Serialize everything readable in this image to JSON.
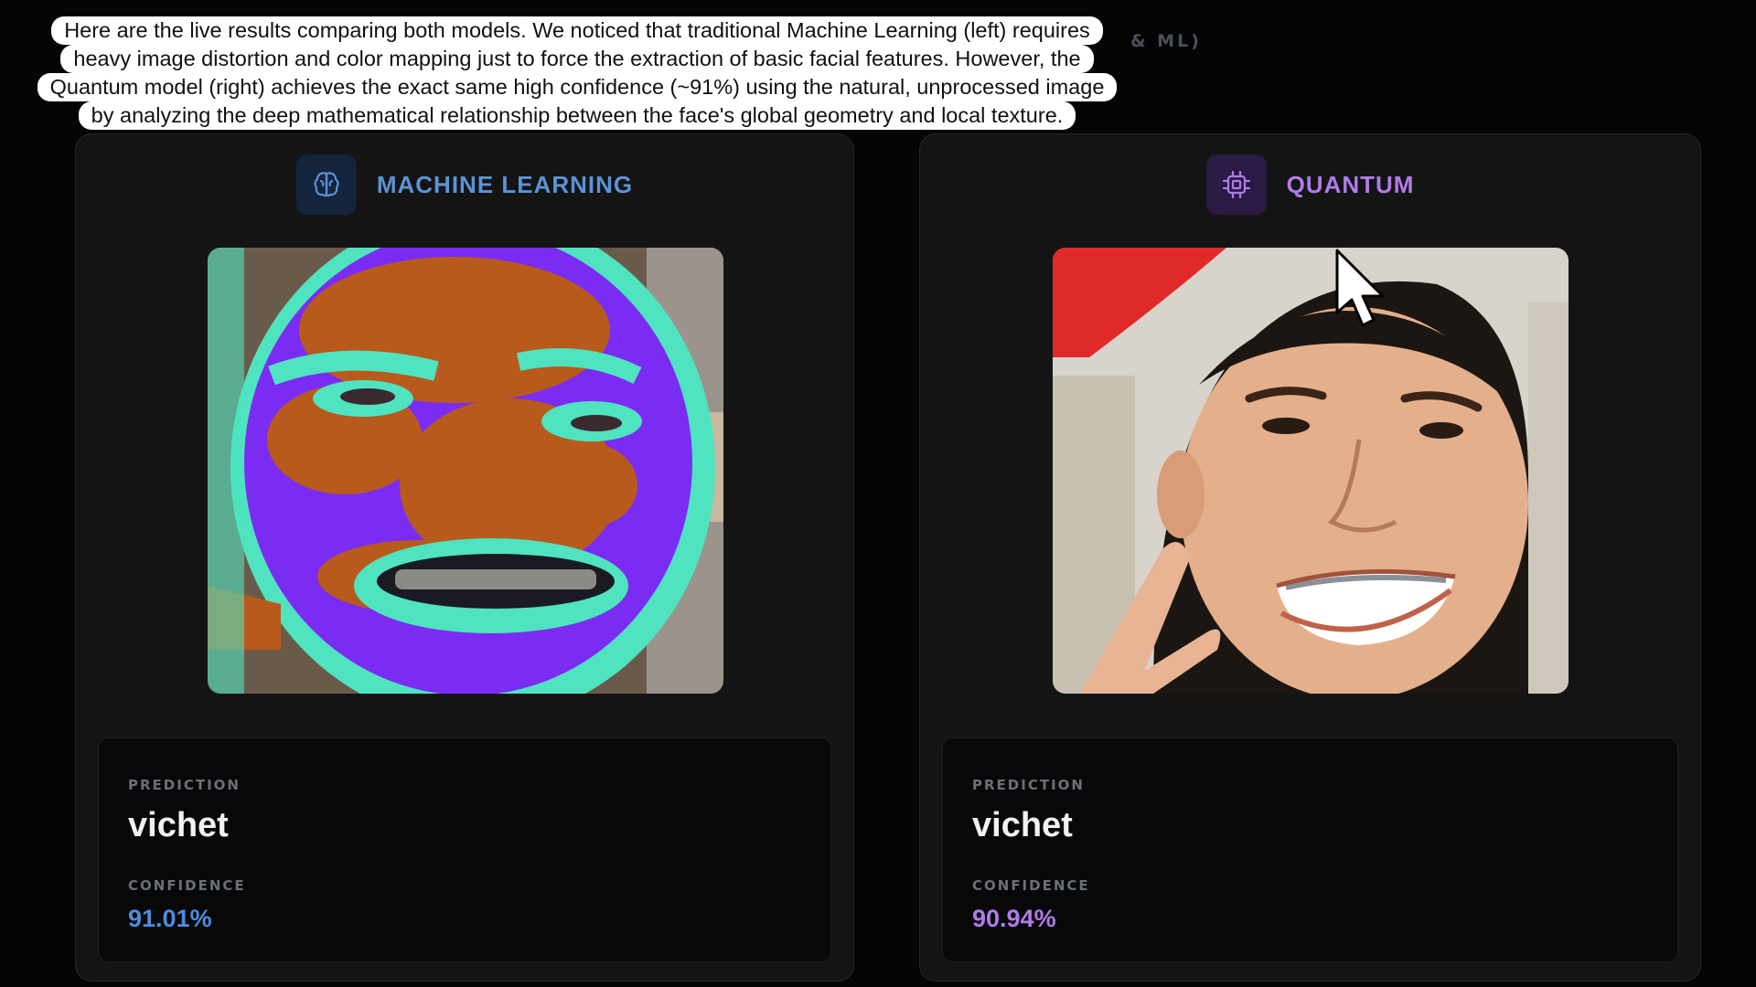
{
  "header": {
    "title_fragment": "& ML)"
  },
  "caption": {
    "lines": [
      "Here are the live results comparing both models. We noticed that traditional Machine Learning (left) requires",
      "heavy image distortion and color mapping just to force the extraction of basic facial features. However, the",
      "Quantum model (right) achieves the exact same high confidence (~91%) using the natural, unprocessed image",
      "by analyzing the deep mathematical relationship between the face's global geometry and local texture."
    ]
  },
  "cards": {
    "ml": {
      "title": "MACHINE LEARNING",
      "icon": "brain-icon",
      "accent": "#5b93d6",
      "prediction_label": "PREDICTION",
      "prediction": "vichet",
      "confidence_label": "CONFIDENCE",
      "confidence": "91.01%"
    },
    "quantum": {
      "title": "QUANTUM",
      "icon": "chip-icon",
      "accent": "#b07ce8",
      "prediction_label": "PREDICTION",
      "prediction": "vichet",
      "confidence_label": "CONFIDENCE",
      "confidence": "90.94%"
    }
  }
}
